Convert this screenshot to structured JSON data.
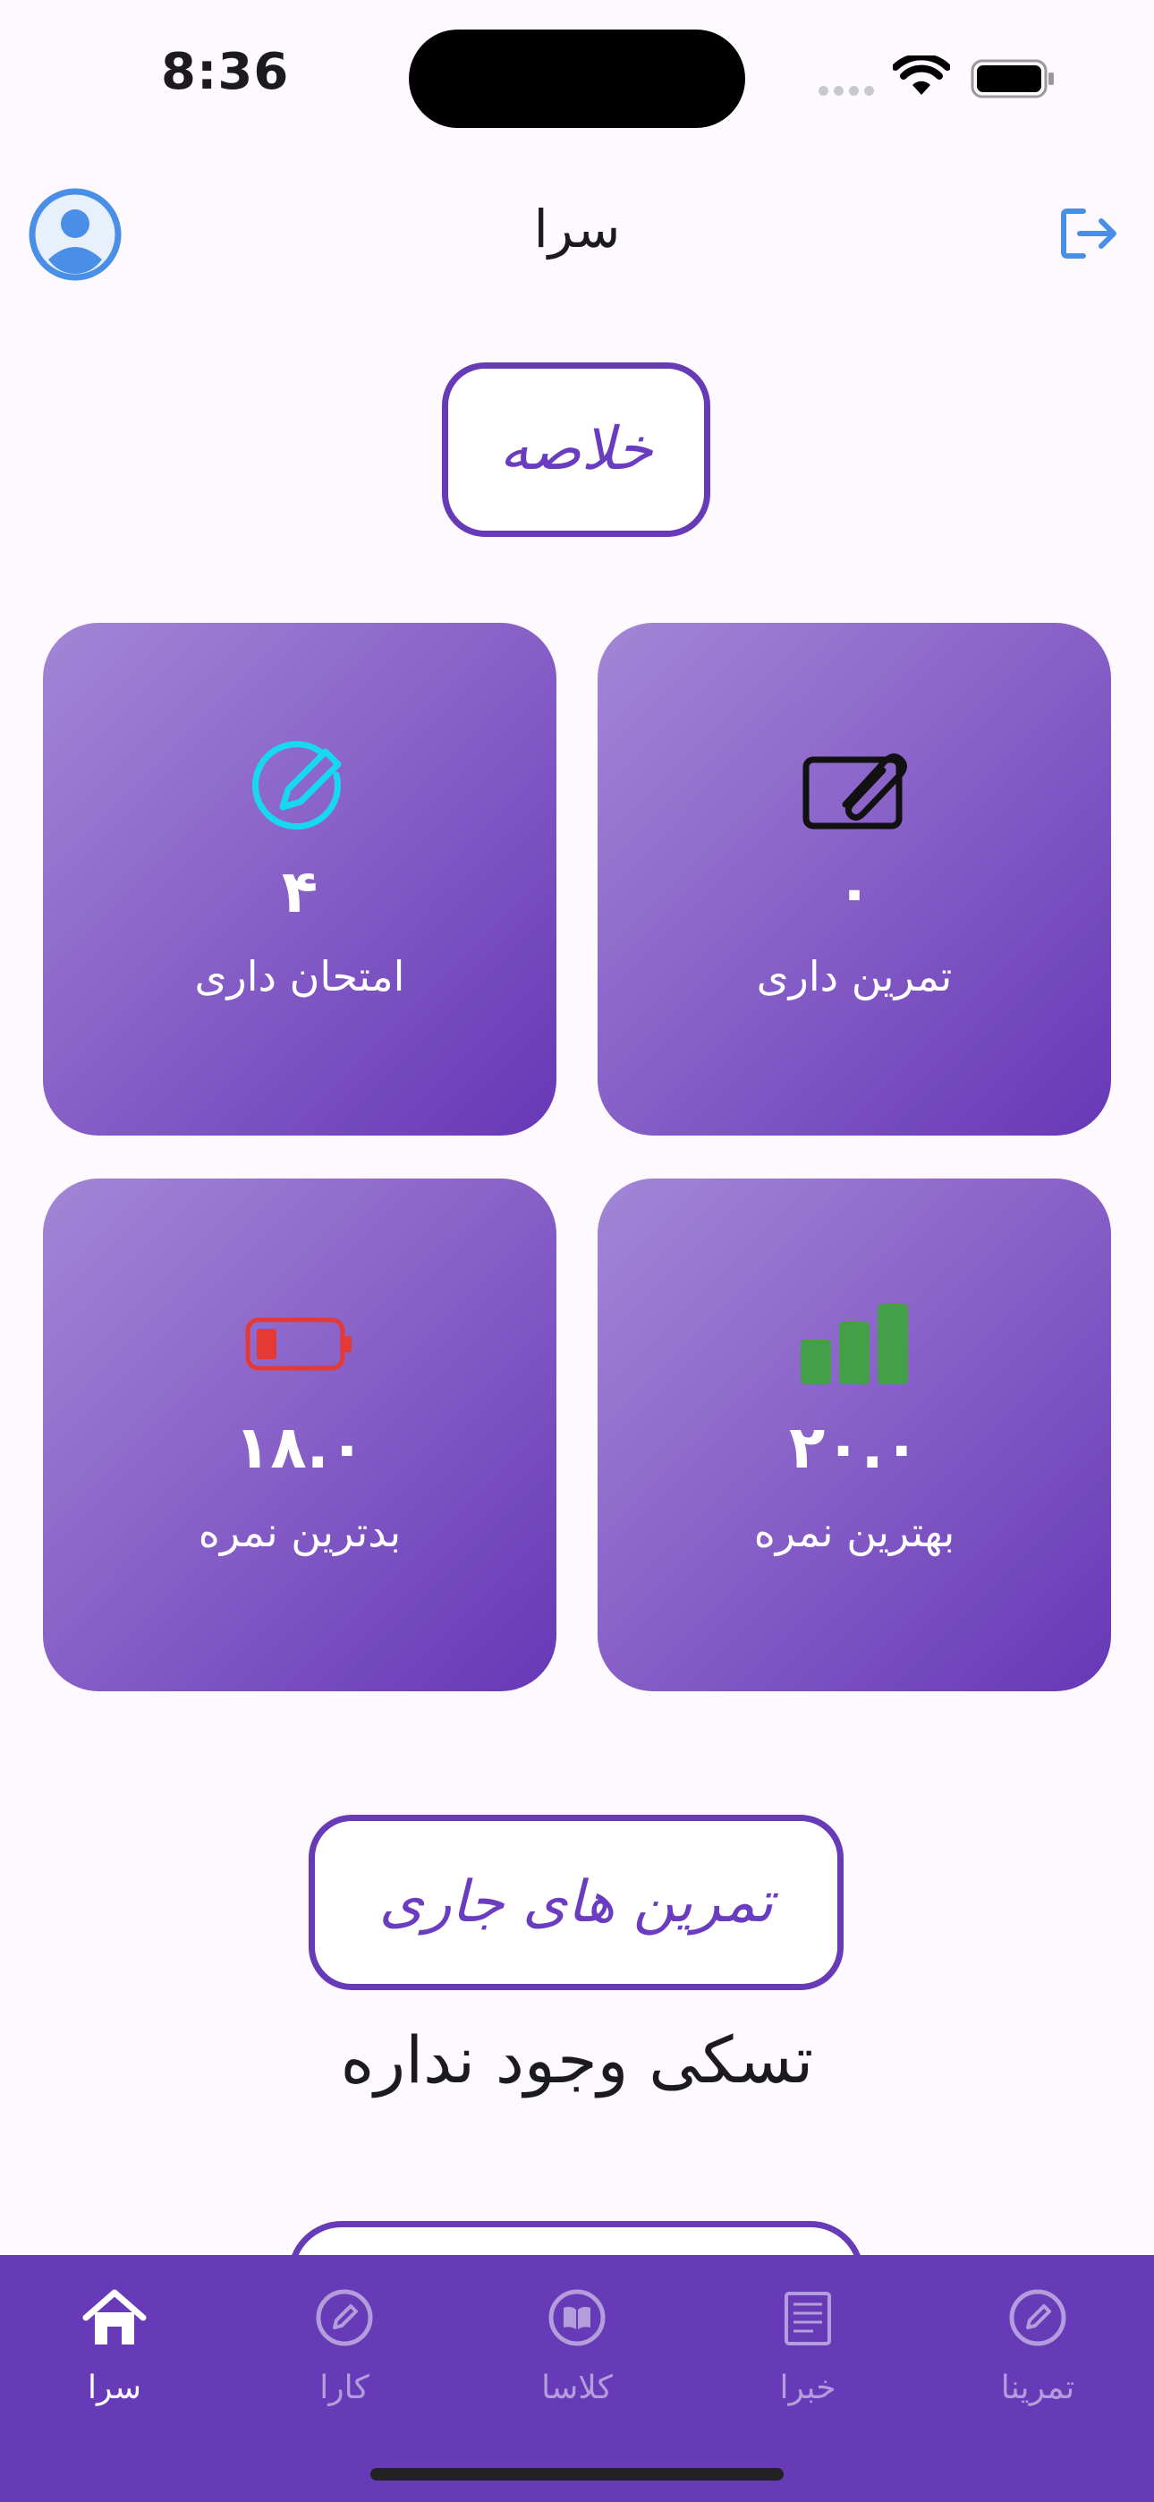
{
  "status_bar": {
    "time": "8:36"
  },
  "app_bar": {
    "title": "سرا"
  },
  "summary": {
    "title": "خلاصه",
    "cards": {
      "tamrin": {
        "value": "۰",
        "label": "تمرین داری"
      },
      "emtehan": {
        "value": "۴",
        "label": "امتحان داری"
      },
      "best": {
        "value": "۲۰.۰",
        "label": "بهترین نمره"
      },
      "worst": {
        "value": "۱۸.۰",
        "label": "بدترین نمره"
      }
    }
  },
  "current_tasks": {
    "title": "تمرین های جاری",
    "empty_text": "تسکی وجود نداره"
  },
  "bottom_nav": {
    "items": [
      {
        "label": "سرا",
        "icon": "home-icon",
        "active": true
      },
      {
        "label": "کارا",
        "icon": "pencil-circle-icon"
      },
      {
        "label": "کلاسا",
        "icon": "book-circle-icon"
      },
      {
        "label": "خبرا",
        "icon": "newspaper-icon"
      },
      {
        "label": "تمرینا",
        "icon": "pencil-circle-icon"
      }
    ]
  },
  "colors": {
    "primary": "#673ab7",
    "card_gradient_start": "#a286d6",
    "card_gradient_end": "#6738b6",
    "exam_icon": "#18d7f0",
    "best_grade_icon": "#43a047",
    "worst_grade_icon": "#e53935",
    "appbar_icons": "#4a8fe7"
  }
}
